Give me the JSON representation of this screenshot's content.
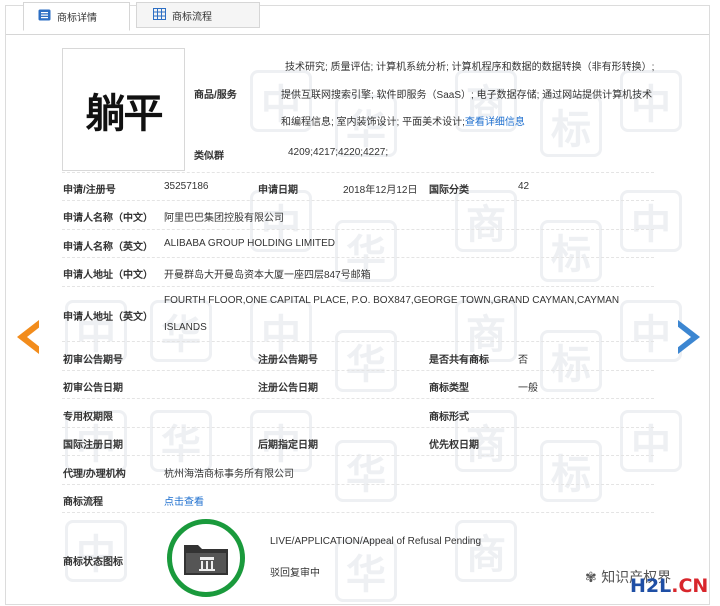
{
  "tabs": {
    "active": "商标详情",
    "inactive": "商标流程"
  },
  "logo_text": "躺平",
  "goods": {
    "label": "商品/服务",
    "lines": [
      "技术研究; 质量评估; 计算机系统分析; 计算机程序和数据的数据转换（非有形转换）;",
      "提供互联网搜索引擎; 软件即服务（SaaS）; 电子数据存储; 通过网站提供计算机技术",
      "和编程信息; 室内装饰设计; 平面美术设计;"
    ],
    "detail_link": "查看详细信息"
  },
  "similar_group": {
    "label": "类似群",
    "value": "4209;4217;4220;4227;"
  },
  "fields": {
    "reg_no_label": "申请/注册号",
    "reg_no": "35257186",
    "apply_date_label": "申请日期",
    "apply_date": "2018年12月12日",
    "intl_class_label": "国际分类",
    "intl_class": "42",
    "applicant_cn_label": "申请人名称（中文）",
    "applicant_cn": "阿里巴巴集团控股有限公司",
    "applicant_en_label": "申请人名称（英文）",
    "applicant_en": "ALIBABA GROUP HOLDING LIMITED",
    "address_cn_label": "申请人地址（中文）",
    "address_cn": "开曼群岛大开曼岛资本大厦一座四层847号邮箱",
    "address_en_label": "申请人地址（英文）",
    "address_en_line1": "FOURTH FLOOR,ONE CAPITAL PLACE, P.O. BOX847,GEORGE TOWN,GRAND CAYMAN,CAYMAN",
    "address_en_line2": "ISLANDS",
    "prelim_no_label": "初审公告期号",
    "reg_pub_no_label": "注册公告期号",
    "shared_label": "是否共有商标",
    "shared_value": "否",
    "prelim_date_label": "初审公告日期",
    "reg_pub_date_label": "注册公告日期",
    "type_label": "商标类型",
    "type_value": "一般",
    "exclusive_period_label": "专用权期限",
    "form_label": "商标形式",
    "intl_reg_date_label": "国际注册日期",
    "later_designation_label": "后期指定日期",
    "priority_date_label": "优先权日期",
    "agency_label": "代理/办理机构",
    "agency_value": "杭州海浩商标事务所有限公司",
    "process_label": "商标流程",
    "process_link": "点击查看",
    "status_icon_label": "商标状态图标",
    "status_en": "LIVE/APPLICATION/Appeal of Refusal Pending",
    "status_cn": "驳回复审中"
  },
  "watermark": {
    "wechat_text": "知识产权界",
    "h2l_blue": "H2L",
    "h2l_red": ".CN"
  },
  "colors": {
    "link": "#1e6fcf",
    "status_green": "#1a9a3c",
    "prev_arrow": "#f28c1c",
    "next_arrow": "#3c86d1"
  }
}
